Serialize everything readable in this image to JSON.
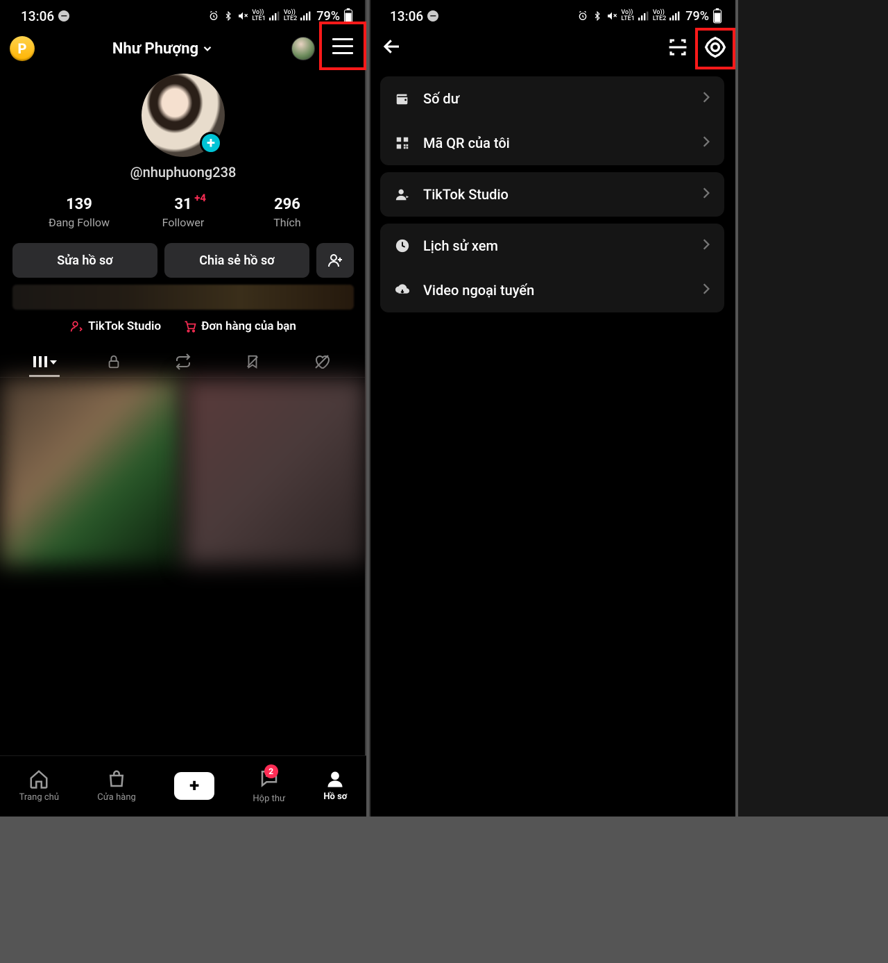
{
  "status": {
    "time": "13:06",
    "battery": "79%"
  },
  "profile": {
    "display_name": "Như Phượng",
    "username": "@nhuphuong238",
    "coin_letter": "P",
    "stats": {
      "following": {
        "value": "139",
        "label": "Đang Follow"
      },
      "followers": {
        "value": "31",
        "label": "Follower",
        "delta": "+4"
      },
      "likes": {
        "value": "296",
        "label": "Thích"
      }
    },
    "actions": {
      "edit": "Sửa hồ sơ",
      "share": "Chia sẻ hồ sơ"
    },
    "mini_links": {
      "studio": "TikTok Studio",
      "orders": "Đơn hàng của bạn"
    }
  },
  "bottom_nav": {
    "home": "Trang chủ",
    "shop": "Cửa hàng",
    "inbox": "Hộp thư",
    "profile": "Hồ sơ",
    "inbox_badge": "2"
  },
  "settings_menu": {
    "balance": "Số dư",
    "qr": "Mã QR của tôi",
    "studio": "TikTok Studio",
    "history": "Lịch sử xem",
    "offline": "Video ngoại tuyến"
  }
}
